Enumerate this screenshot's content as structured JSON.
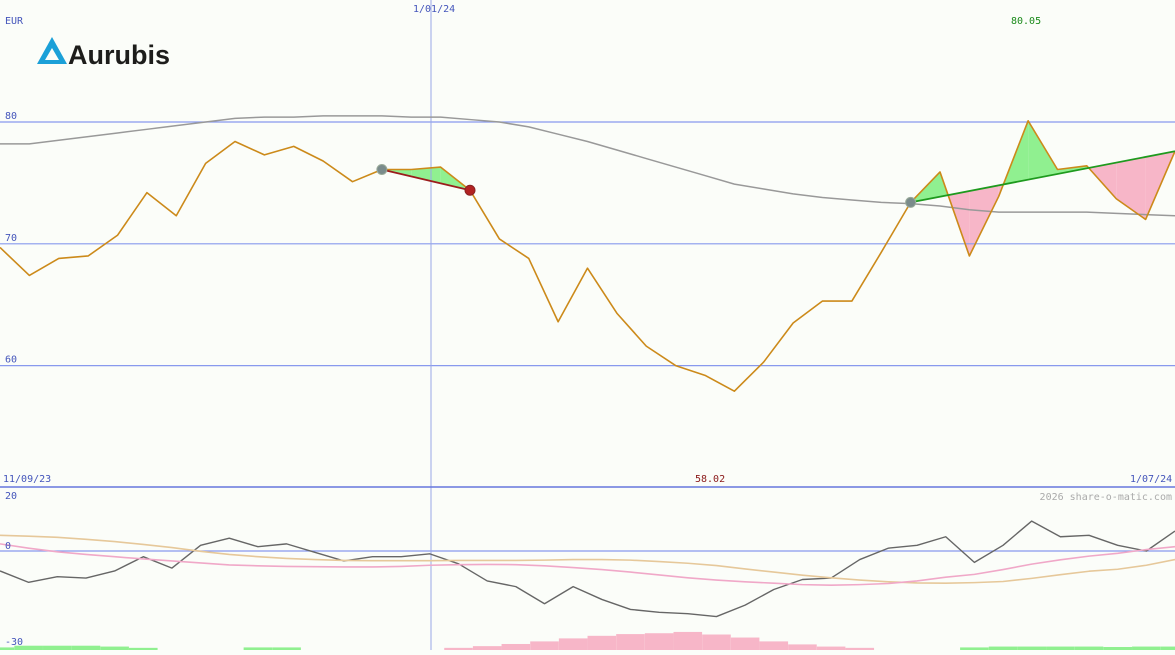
{
  "brand": {
    "name": "Aurubis",
    "accent": "#1ba0d8"
  },
  "currency": "EUR",
  "watermark": "2026 share-o-matic.com",
  "labels": {
    "date_top": "1/01/24",
    "high": "80.05",
    "date_start": "11/09/23",
    "low": "58.02",
    "date_end": "1/07/24"
  },
  "colors": {
    "price": "#cc8a1a",
    "ma_long": "#999999",
    "grid": "#8899ee",
    "trend_up": "#1e9a1e",
    "trend_down": "#9b1c1c",
    "fill_up": "#90f090",
    "fill_down": "#f7b6c8",
    "high_text": "#1a8a1a",
    "low_text": "#8b1a1a"
  },
  "chart_data": [
    {
      "type": "line",
      "name": "price",
      "y_ticks": [
        60,
        70,
        80
      ],
      "ylim": [
        50,
        90
      ],
      "x": [
        0,
        1,
        2,
        3,
        4,
        5,
        6,
        7,
        8,
        9,
        10,
        11,
        12,
        13,
        14,
        15,
        16,
        17,
        18,
        19,
        20,
        21,
        22,
        23,
        24,
        25,
        26,
        27,
        28,
        29,
        30,
        31,
        32,
        33,
        34,
        35,
        36,
        37,
        38,
        39,
        40
      ],
      "series": [
        {
          "key": "price",
          "values": [
            69.7,
            67.4,
            68.8,
            69.0,
            70.7,
            74.2,
            72.3,
            76.6,
            78.4,
            77.3,
            78.0,
            76.8,
            75.1,
            76.1,
            76.1,
            76.3,
            74.4,
            70.4,
            68.8,
            63.6,
            68.0,
            64.3,
            61.6,
            60.0,
            59.2,
            57.9,
            60.3,
            63.5,
            65.3,
            65.3,
            69.3,
            73.4,
            75.9,
            69.0,
            73.9,
            80.1,
            76.1,
            76.4,
            73.7,
            72.0,
            77.6
          ]
        },
        {
          "key": "ma_long",
          "values": [
            78.2,
            78.2,
            78.5,
            78.8,
            79.1,
            79.4,
            79.7,
            80.0,
            80.3,
            80.4,
            80.4,
            80.5,
            80.5,
            80.5,
            80.4,
            80.4,
            80.2,
            80.0,
            79.6,
            79.0,
            78.4,
            77.7,
            77.0,
            76.3,
            75.6,
            74.9,
            74.5,
            74.1,
            73.8,
            73.6,
            73.4,
            73.3,
            73.1,
            72.8,
            72.6,
            72.6,
            72.6,
            72.6,
            72.5,
            72.4,
            72.3
          ]
        }
      ],
      "trendlines": [
        {
          "direction": "down",
          "from": {
            "x": 13,
            "y": 76.1
          },
          "to": {
            "x": 16,
            "y": 74.4
          }
        },
        {
          "direction": "up",
          "from": {
            "x": 31,
            "y": 73.4
          },
          "to": {
            "x": 40,
            "y": 77.6
          }
        }
      ],
      "annotations": {
        "max_label": "80.05",
        "min_label": "58.02"
      }
    },
    {
      "type": "line",
      "name": "oscillator",
      "y_ticks": [
        20,
        0,
        -30
      ],
      "ylim": [
        -30,
        20
      ],
      "series": [
        {
          "key": "momentum",
          "color": "#666666",
          "values": [
            -7,
            -11,
            -9,
            -9.5,
            -7,
            -2,
            -6,
            2,
            4.5,
            1.5,
            2.5,
            -0.5,
            -3.5,
            -2,
            -2,
            -1,
            -4.5,
            -10.5,
            -12.5,
            -18.5,
            -12.5,
            -17,
            -20.5,
            -21.5,
            -22,
            -23,
            -19,
            -13.5,
            -10,
            -9.5,
            -3,
            1,
            2,
            5,
            -4,
            2,
            10.5,
            5,
            5.5,
            2,
            0,
            7
          ]
        },
        {
          "key": "signal_slow",
          "color": "#e6c89a",
          "values": [
            5.5,
            5.2,
            4.8,
            4.1,
            3.3,
            2.3,
            1.2,
            -0.1,
            -1.2,
            -2,
            -2.6,
            -3,
            -3.3,
            -3.4,
            -3.4,
            -3.4,
            -3.3,
            -3.3,
            -3.3,
            -3.2,
            -3,
            -3,
            -3.2,
            -3.7,
            -4.3,
            -5.1,
            -6.3,
            -7.4,
            -8.5,
            -9.4,
            -10.2,
            -10.8,
            -11.2,
            -11.3,
            -11.1,
            -10.7,
            -9.6,
            -8.3,
            -7.1,
            -6.4,
            -5,
            -3
          ]
        },
        {
          "key": "signal_fast",
          "color": "#f0a8c8",
          "values": [
            2.5,
            1,
            -0.3,
            -1.2,
            -2,
            -2.8,
            -3.5,
            -4.2,
            -4.9,
            -5.2,
            -5.4,
            -5.5,
            -5.6,
            -5.6,
            -5.4,
            -5,
            -4.8,
            -4.7,
            -4.8,
            -5.2,
            -5.8,
            -6.5,
            -7.4,
            -8.4,
            -9.4,
            -10.2,
            -10.8,
            -11.3,
            -11.8,
            -12,
            -11.8,
            -11.4,
            -10.5,
            -9.2,
            -8.2,
            -6.5,
            -4.6,
            -3.1,
            -1.8,
            -0.8,
            0.5,
            1.5
          ]
        }
      ],
      "histogram": [
        {
          "from": 0,
          "to": 5,
          "sign": "pos",
          "magnitude": [
            0.6,
            1,
            1,
            1,
            0.8,
            0.5
          ]
        },
        {
          "from": 9,
          "to": 10,
          "sign": "pos",
          "magnitude": [
            0.6,
            0.6
          ]
        },
        {
          "from": 16,
          "to": 30,
          "sign": "neg",
          "magnitude": [
            0.5,
            0.9,
            1.4,
            2,
            2.7,
            3.3,
            3.7,
            3.9,
            4.2,
            3.6,
            2.9,
            2,
            1.3,
            0.8,
            0.5
          ]
        },
        {
          "from": 34,
          "to": 39,
          "sign": "pos",
          "magnitude": [
            0.6,
            0.8,
            0.8,
            0.8,
            0.8,
            0.7
          ]
        },
        {
          "from": 40,
          "to": 41,
          "sign": "pos",
          "magnitude": [
            0.8,
            0.8
          ]
        }
      ]
    }
  ]
}
